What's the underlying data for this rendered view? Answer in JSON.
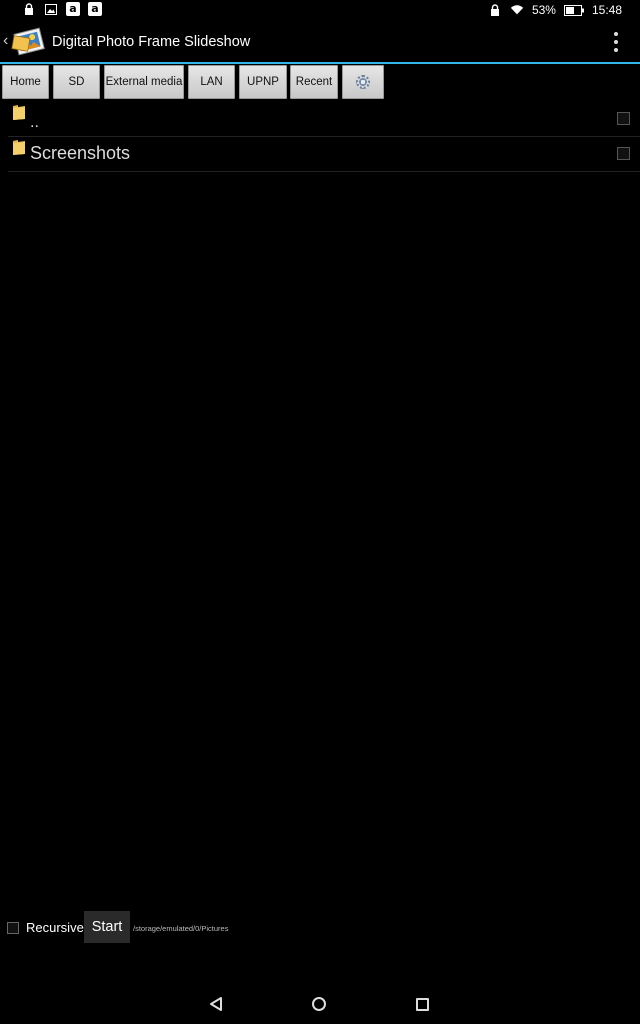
{
  "status_bar": {
    "left_icons": [
      "lock-icon",
      "image-icon",
      "amazon-icon",
      "amazon-icon"
    ],
    "battery": "53%",
    "time": "15:48"
  },
  "action_bar": {
    "title": "Digital Photo Frame Slideshow"
  },
  "tabs": [
    {
      "label": "Home"
    },
    {
      "label": "SD"
    },
    {
      "label": "External media"
    },
    {
      "label": "LAN"
    },
    {
      "label": "UPNP"
    },
    {
      "label": "Recent"
    },
    {
      "label": "",
      "icon": "settings-gear-icon"
    }
  ],
  "files": [
    {
      "name": "..",
      "icon": "folder-icon"
    },
    {
      "name": "Screenshots",
      "icon": "folder-icon"
    }
  ],
  "bottom": {
    "recursive_label": "Recursive",
    "start_label": "Start",
    "path": "/storage/emulated/0/Pictures"
  },
  "colors": {
    "accent": "#33b5e5",
    "background": "#000000",
    "folder": "#e8b94a"
  }
}
